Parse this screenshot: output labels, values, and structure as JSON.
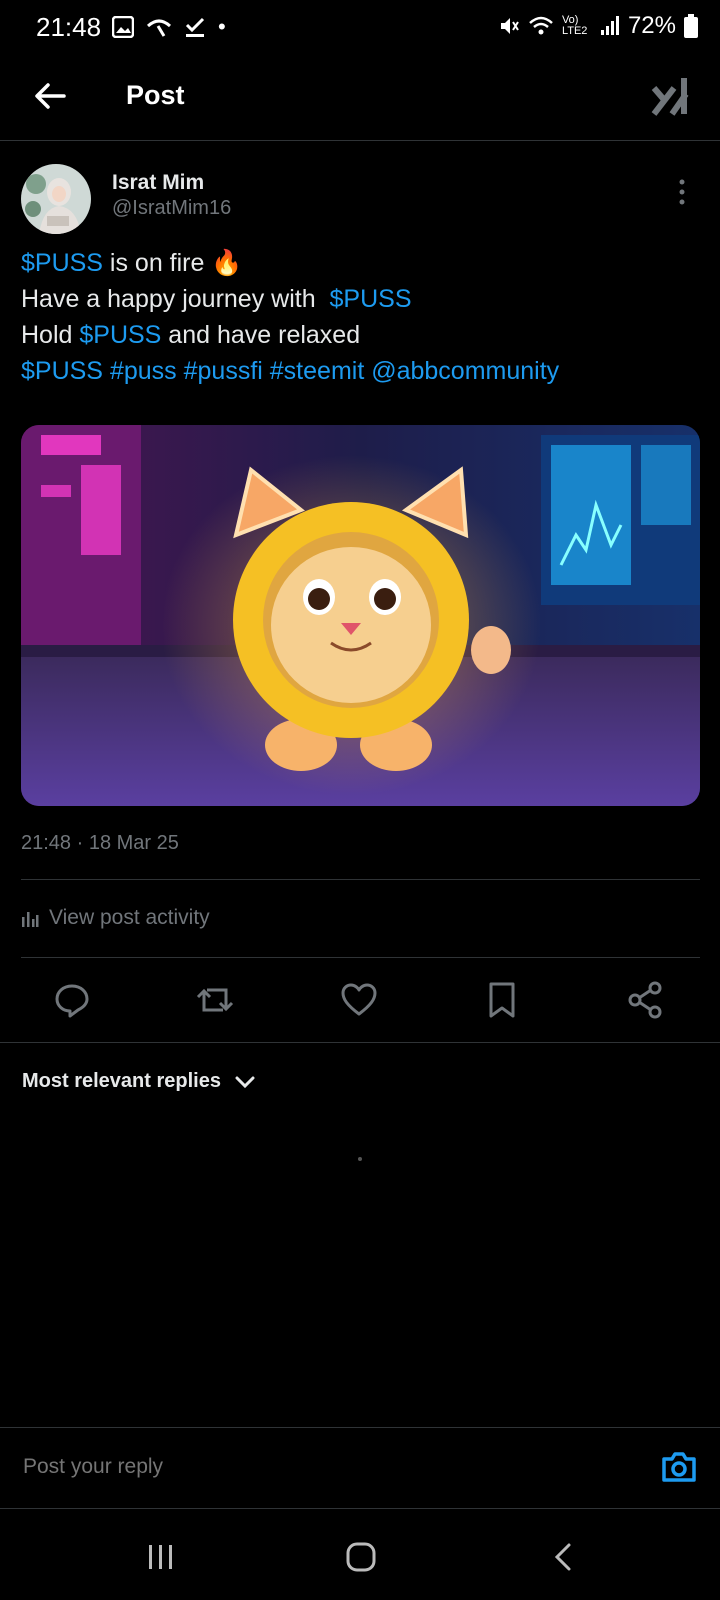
{
  "status_bar": {
    "time": "21:48",
    "dot": "•",
    "battery": "72%",
    "network": "Vo) LTE2"
  },
  "header": {
    "title": "Post",
    "back_icon": "arrow-left-icon",
    "logo": "grok-logo"
  },
  "post": {
    "author_name": "Israt Mim",
    "author_handle": "@IsratMim16",
    "lines": [
      [
        {
          "t": "$PUSS",
          "link": true
        },
        {
          "t": " is on fire 🔥",
          "link": false
        }
      ],
      [
        {
          "t": "Have a happy journey with  ",
          "link": false
        },
        {
          "t": "$PUSS",
          "link": true
        }
      ],
      [
        {
          "t": "Hold ",
          "link": false
        },
        {
          "t": "$PUSS",
          "link": true
        },
        {
          "t": " and have relaxed",
          "link": false
        }
      ],
      [
        {
          "t": "$PUSS",
          "link": true
        },
        {
          "t": " ",
          "link": false
        },
        {
          "t": "#puss",
          "link": true
        },
        {
          "t": " ",
          "link": false
        },
        {
          "t": "#pussfi",
          "link": true
        },
        {
          "t": " ",
          "link": false
        },
        {
          "t": "#steemit",
          "link": true
        },
        {
          "t": " ",
          "link": false
        },
        {
          "t": "@abbcommunity",
          "link": true
        }
      ]
    ],
    "timestamp": "21:48 · 18 Mar 25",
    "activity_label": "View post activity"
  },
  "actions": [
    "reply-icon",
    "repost-icon",
    "like-icon",
    "bookmark-icon",
    "share-icon"
  ],
  "replies": {
    "filter_label": "Most relevant replies"
  },
  "reply_bar": {
    "placeholder": "Post your reply"
  },
  "colors": {
    "link": "#1d9bf0",
    "muted": "#71767b",
    "divider": "#2f3336"
  }
}
